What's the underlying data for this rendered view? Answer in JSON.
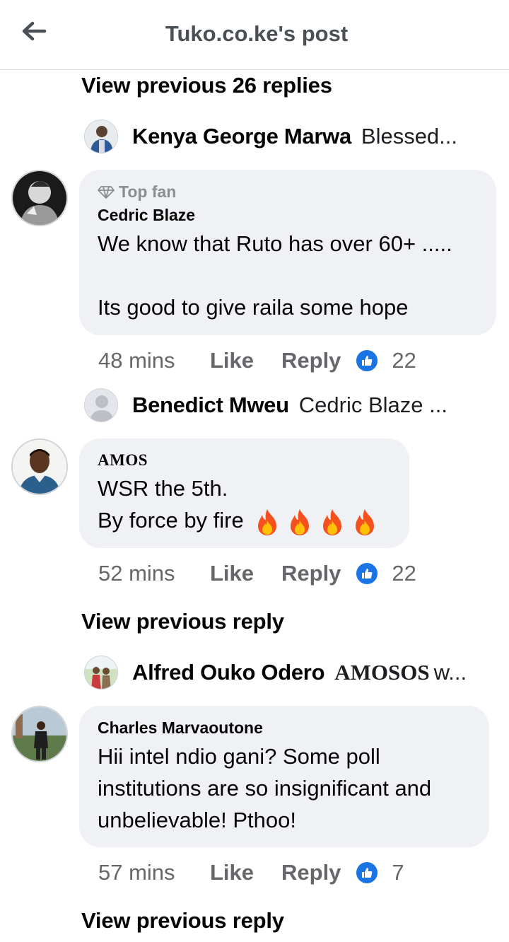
{
  "header": {
    "title": "Tuko.co.ke's post",
    "back_icon": "arrow-left-icon"
  },
  "thread1": {
    "view_previous": "View previous 26 replies",
    "reply_preview": {
      "name": "Kenya George Marwa",
      "text": "Blessed..."
    },
    "comment": {
      "badge": "Top fan",
      "author": "Cedric Blaze",
      "text_line1": "We know that Ruto has over 60+ .....",
      "text_line2": "Its good to give raila some hope",
      "time": "48 mins",
      "like_label": "Like",
      "reply_label": "Reply",
      "reactions": "22"
    },
    "reply_preview2": {
      "name": "Benedict Mweu",
      "text": "Cedric Blaze ..."
    }
  },
  "thread2": {
    "comment": {
      "author": "AMOS",
      "text_line1": "WSR the 5th.",
      "text_line2": "By force by fire",
      "emoji": "🔥🔥🔥🔥",
      "time": "52 mins",
      "like_label": "Like",
      "reply_label": "Reply",
      "reactions": "22"
    },
    "view_previous": "View previous reply",
    "reply_preview": {
      "name": "Alfred Ouko Odero",
      "text_name": "AMOSOS",
      "text": "w..."
    }
  },
  "thread3": {
    "comment": {
      "author": "Charles Marvaoutone",
      "text_line1": "Hii intel ndio gani? Some poll",
      "text_line2": "institutions are so insignificant and",
      "text_line3": "unbelievable! Pthoo!",
      "time": "57 mins",
      "like_label": "Like",
      "reply_label": "Reply",
      "reactions": "7"
    },
    "view_previous": "View previous reply"
  },
  "colors": {
    "bubble": "#eff1f5",
    "like_blue": "#1b74e4",
    "meta_gray": "#65676b"
  }
}
